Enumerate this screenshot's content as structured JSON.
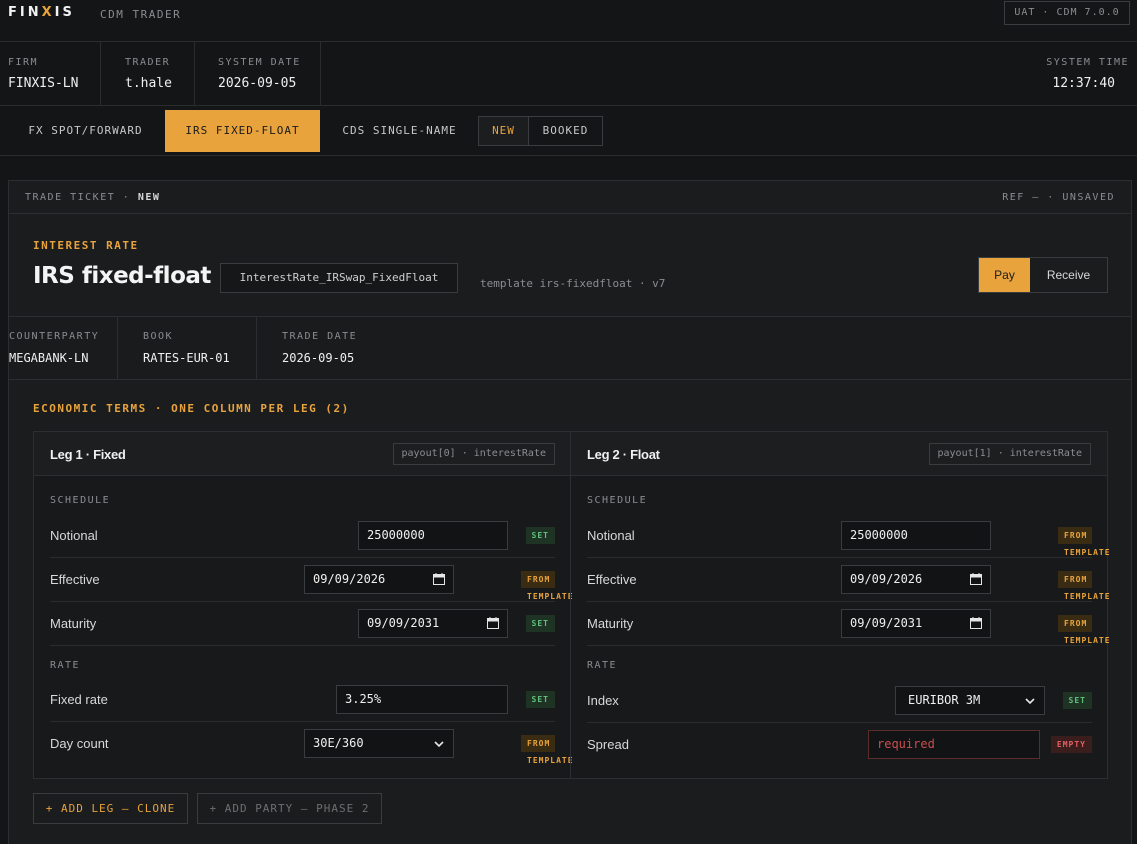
{
  "app": {
    "logo_left": "FIN",
    "logo_x": "X",
    "logo_right": "IS",
    "name": "CDM TRADER",
    "env": "UAT · CDM 7.0.0"
  },
  "info": {
    "firm_label": "FIRM",
    "firm": "FINXIS-LN",
    "trader_label": "TRADER",
    "trader": "t.hale",
    "date_label": "SYSTEM DATE",
    "date": "2026-09-05",
    "time_label": "SYSTEM TIME",
    "time": "12:37:40"
  },
  "tabs": [
    {
      "label": "FX SPOT/FORWARD",
      "active": false
    },
    {
      "label": "IRS FIXED-FLOAT",
      "active": true
    },
    {
      "label": "CDS SINGLE-NAME",
      "active": false
    }
  ],
  "status_toggle": {
    "new": "NEW",
    "booked": "BOOKED"
  },
  "ticket": {
    "head_prefix": "TRADE TICKET · ",
    "head_state": "NEW",
    "ref": "REF — · UNSAVED",
    "kicker": "INTEREST RATE",
    "title": "IRS fixed-float",
    "cdm_type": "InterestRate_IRSwap_FixedFloat",
    "template": "template irs-fixedfloat · v7",
    "direction": {
      "pay": "Pay",
      "receive": "Receive",
      "selected": "Pay"
    }
  },
  "meta": {
    "counterparty_label": "COUNTERPARTY",
    "counterparty": "MEGABANK-LN",
    "book_label": "BOOK",
    "book": "RATES-EUR-01",
    "trade_date_label": "TRADE DATE",
    "trade_date": "2026-09-05"
  },
  "econ_title": "ECONOMIC TERMS · ONE COLUMN PER LEG (2)",
  "legs": [
    {
      "title": "Leg 1 · Fixed",
      "path": "payout[0] · interestRate",
      "schedule_label": "SCHEDULE",
      "rate_label": "RATE",
      "notional": {
        "label": "Notional",
        "value": "25000000",
        "badge": "SET"
      },
      "effective": {
        "label": "Effective",
        "value": "09/09/2026",
        "badge": "FROM TEMPLATE"
      },
      "maturity": {
        "label": "Maturity",
        "value": "09/09/2031",
        "badge": "SET"
      },
      "rate1": {
        "label": "Fixed rate",
        "value": "3.25%",
        "badge": "SET"
      },
      "rate2": {
        "label": "Day count",
        "value": "30E/360",
        "badge": "FROM TEMPLATE"
      }
    },
    {
      "title": "Leg 2 · Float",
      "path": "payout[1] · interestRate",
      "schedule_label": "SCHEDULE",
      "rate_label": "RATE",
      "notional": {
        "label": "Notional",
        "value": "25000000",
        "badge": "FROM TEMPLATE"
      },
      "effective": {
        "label": "Effective",
        "value": "09/09/2026",
        "badge": "FROM TEMPLATE"
      },
      "maturity": {
        "label": "Maturity",
        "value": "09/09/2031",
        "badge": "FROM TEMPLATE"
      },
      "rate1": {
        "label": "Index",
        "value": "EURIBOR 3M",
        "badge": "SET"
      },
      "rate2": {
        "label": "Spread",
        "value": "required",
        "badge": "EMPTY"
      }
    }
  ],
  "actions": {
    "add_leg": "+ ADD LEG — CLONE",
    "add_party": "+ ADD PARTY — PHASE 2"
  },
  "colors": {
    "accent": "#e8a33d",
    "set": "#5fc07a",
    "empty": "#e06060",
    "background": "#141516"
  }
}
